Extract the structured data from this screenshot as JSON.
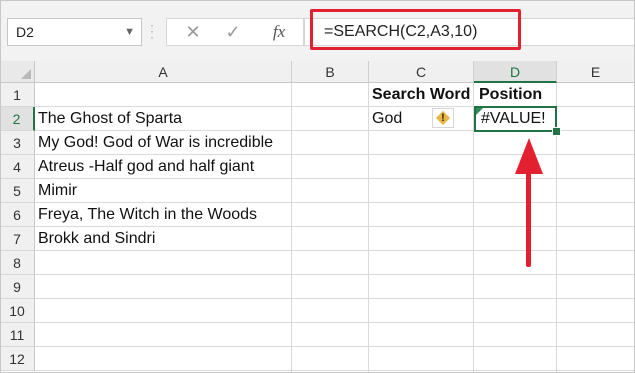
{
  "name_box": {
    "value": "D2"
  },
  "formula_bar": {
    "cancel_icon": "close-icon",
    "enter_icon": "check-icon",
    "fx_label": "fx",
    "formula": "=SEARCH(C2,A3,10)"
  },
  "columns": [
    "A",
    "B",
    "C",
    "D",
    "E"
  ],
  "rows": [
    "1",
    "2",
    "3",
    "4",
    "5",
    "6",
    "7",
    "8",
    "9",
    "10",
    "11",
    "12"
  ],
  "cells": {
    "A2": "The Ghost of Sparta",
    "A3": "My God! God of War is incredible",
    "A4": "Atreus -Half god and half giant",
    "A5": "Mimir",
    "A6": "Freya, The Witch in the Woods",
    "A7": "Brokk and Sindri",
    "C1": "Search Word",
    "D1": "Position",
    "C2": "God",
    "D2": "#VALUE!"
  },
  "error_indicator": {
    "icon": "warning-diamond-icon",
    "symbol": "!"
  },
  "colors": {
    "accent_green": "#217346",
    "annotation_red": "#e2202f"
  }
}
